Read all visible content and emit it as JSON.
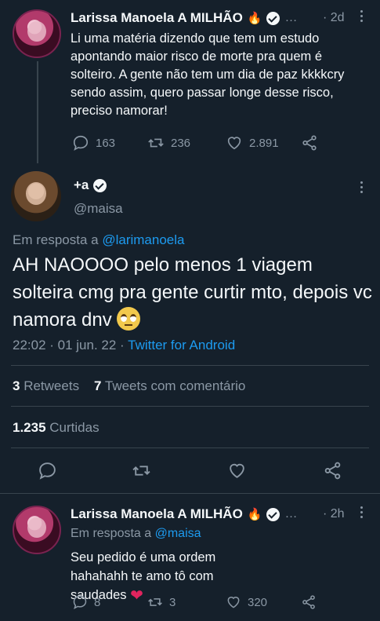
{
  "tweet1": {
    "name": "Larissa Manoela A MILHÃO",
    "ellipsis": "…",
    "time": "· 2d",
    "text": "Li uma matéria dizendo que tem um estudo apontando maior risco de morte pra quem é solteiro. A gente não tem um dia de paz kkkkcry sendo assim, quero passar longe desse risco, preciso namorar!",
    "replies": "163",
    "retweets": "236",
    "likes": "2.891"
  },
  "main_tweet": {
    "name": "+a",
    "handle": "@maisa",
    "reply_prefix": "Em resposta a",
    "reply_to": "@larimanoela",
    "text": "AH NAOOOO pelo menos 1 viagem solteira cmg pra gente curtir mto, depois vc namora dnv",
    "timestamp": "22:02 · 01 jun. 22 ·",
    "source": "Twitter for Android",
    "retweets_count": "3",
    "retweets_label": "Retweets",
    "quotes_count": "7",
    "quotes_label": "Tweets com comentário",
    "likes_count": "1.235",
    "likes_label": "Curtidas"
  },
  "reply": {
    "name": "Larissa Manoela A MILHÃO",
    "ellipsis": "…",
    "time": "· 2h",
    "reply_prefix": "Em resposta a",
    "reply_to": "@maisa",
    "text": "Seu pedido é uma ordem hahahahh te amo tô com saudades",
    "replies": "8",
    "retweets": "3",
    "likes": "320"
  },
  "colors": {
    "background": "#15202b",
    "accent": "#1d9bf0",
    "muted": "#8b98a5",
    "divider": "#38444d"
  }
}
